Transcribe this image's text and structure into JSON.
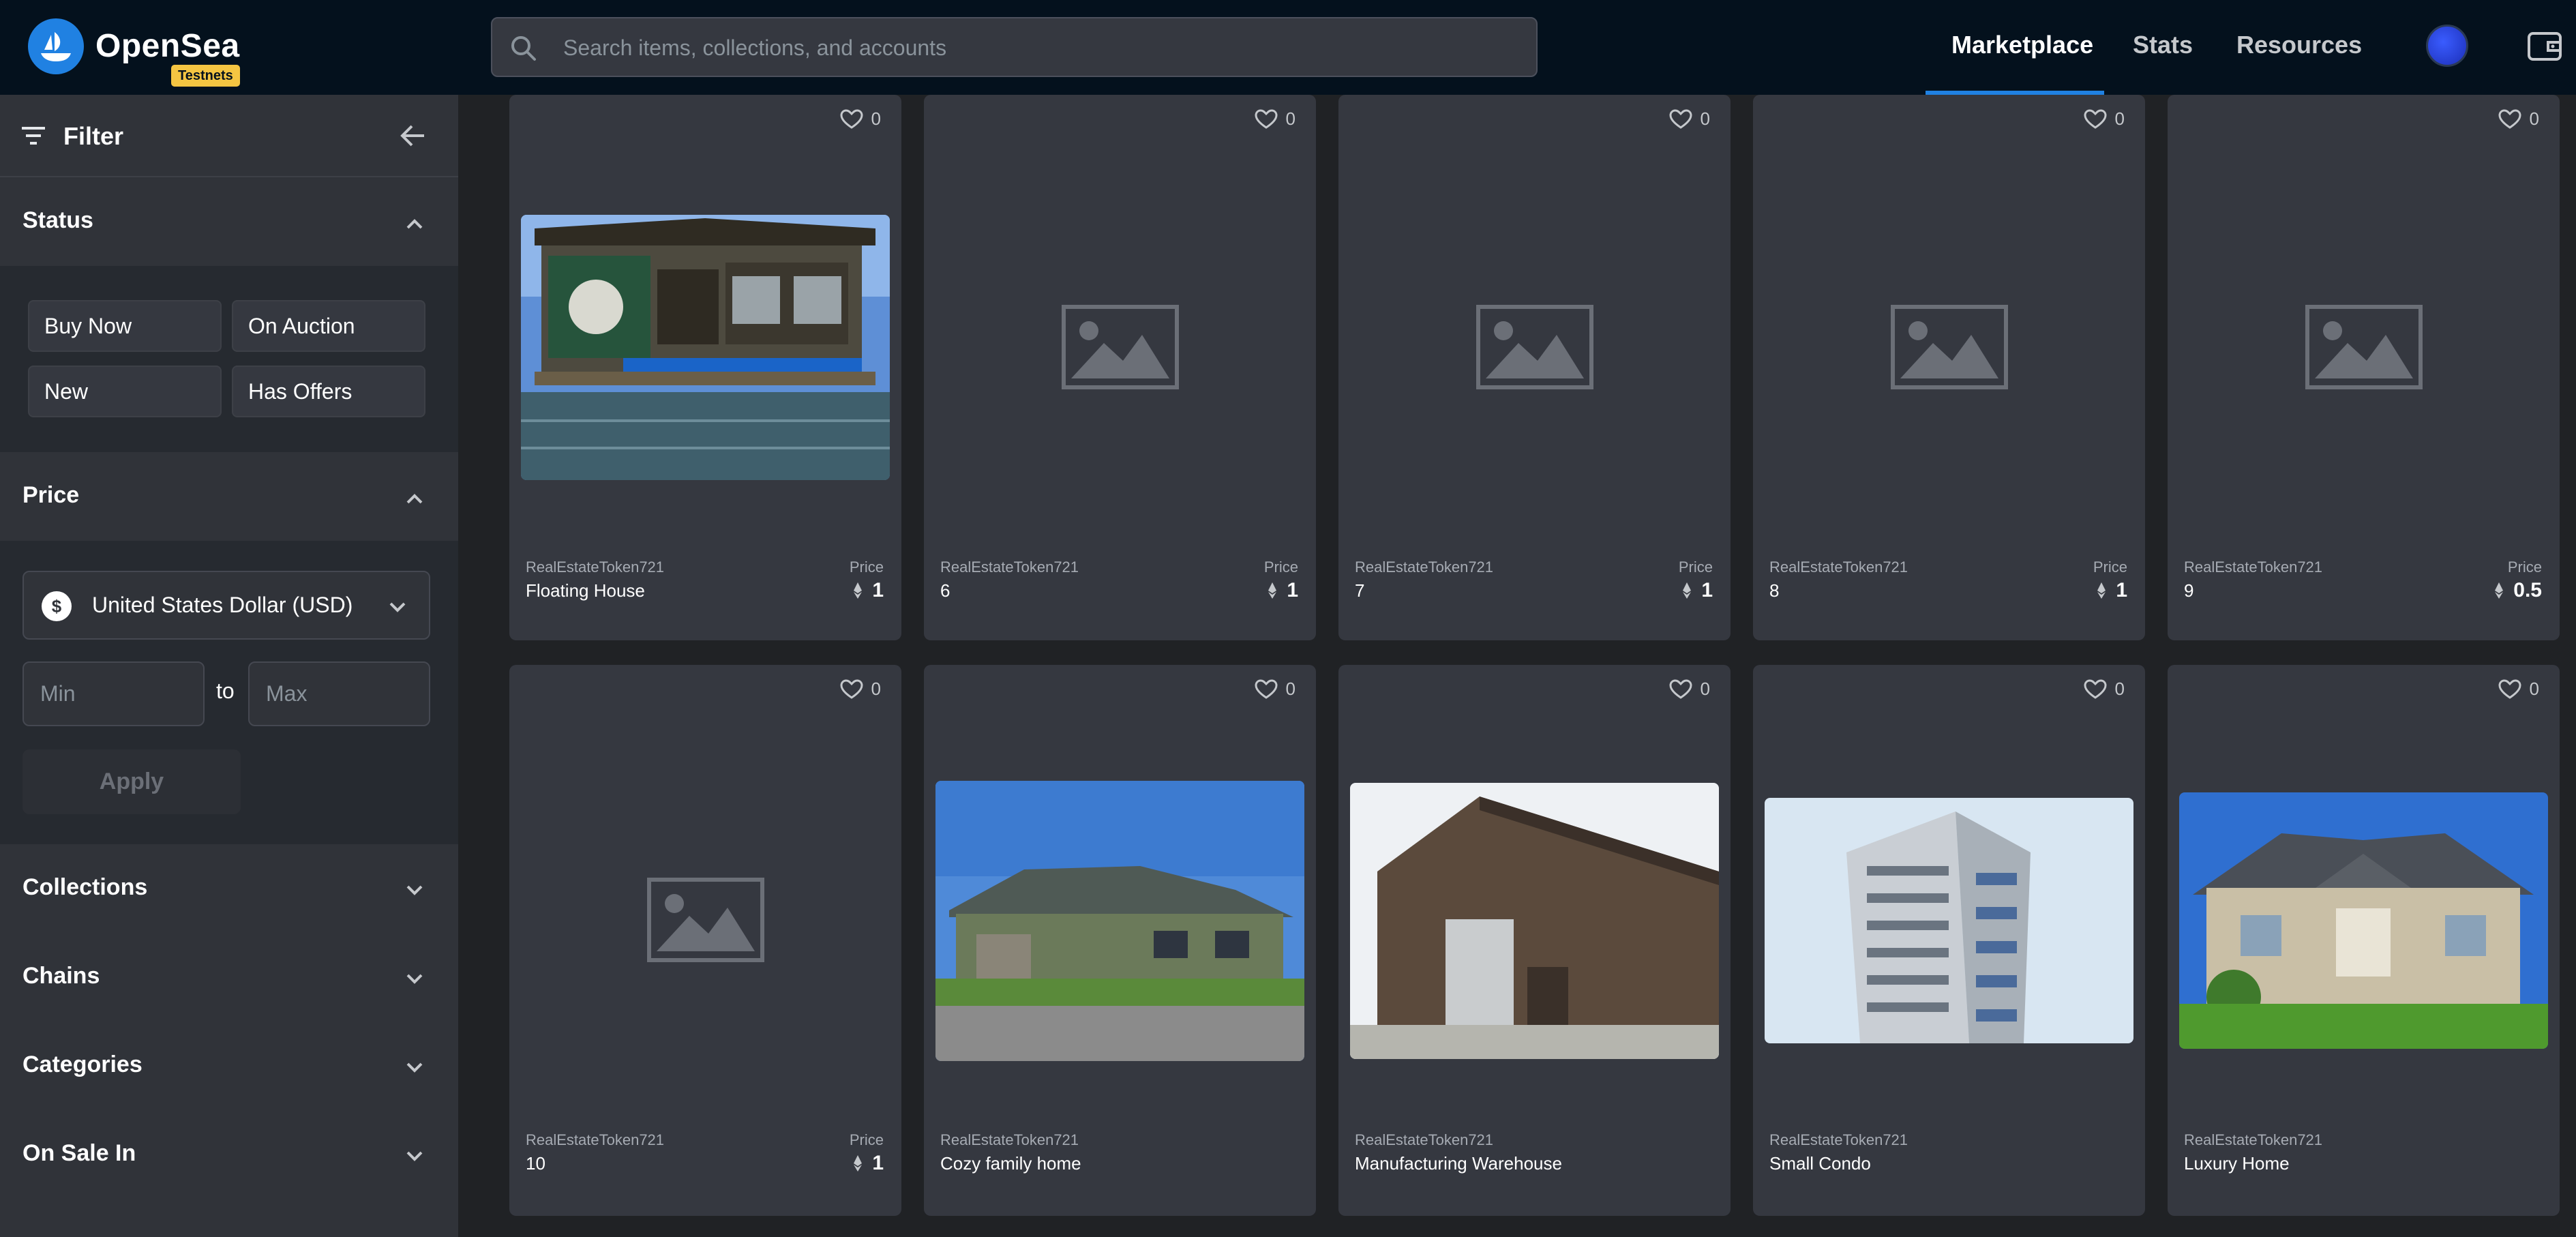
{
  "header": {
    "brand": "OpenSea",
    "badge": "Testnets",
    "search_placeholder": "Search items, collections, and accounts",
    "nav": [
      "Marketplace",
      "Stats",
      "Resources"
    ],
    "active_nav": "Marketplace",
    "accent": "#2081e2"
  },
  "sidebar": {
    "filter_label": "Filter",
    "status": {
      "title": "Status",
      "options": [
        "Buy Now",
        "On Auction",
        "New",
        "Has Offers"
      ]
    },
    "price": {
      "title": "Price",
      "currency_symbol": "$",
      "currency": "United States Dollar (USD)",
      "min_placeholder": "Min",
      "max_placeholder": "Max",
      "to_label": "to",
      "apply_label": "Apply"
    },
    "collapsed_sections": [
      "Collections",
      "Chains",
      "Categories",
      "On Sale In"
    ]
  },
  "cards": [
    {
      "collection": "RealEstateToken721",
      "name": "Floating House",
      "price_label": "Price",
      "price": "1",
      "likes": "0",
      "image": "houseboat"
    },
    {
      "collection": "RealEstateToken721",
      "name": "6",
      "price_label": "Price",
      "price": "1",
      "likes": "0",
      "image": "placeholder"
    },
    {
      "collection": "RealEstateToken721",
      "name": "7",
      "price_label": "Price",
      "price": "1",
      "likes": "0",
      "image": "placeholder"
    },
    {
      "collection": "RealEstateToken721",
      "name": "8",
      "price_label": "Price",
      "price": "1",
      "likes": "0",
      "image": "placeholder"
    },
    {
      "collection": "RealEstateToken721",
      "name": "9",
      "price_label": "Price",
      "price": "0.5",
      "likes": "0",
      "image": "placeholder"
    },
    {
      "collection": "RealEstateToken721",
      "name": "10",
      "price_label": "Price",
      "price": "1",
      "likes": "0",
      "image": "placeholder"
    },
    {
      "collection": "RealEstateToken721",
      "name": "Cozy family home",
      "price_label": "",
      "price": "",
      "likes": "0",
      "image": "family-home"
    },
    {
      "collection": "RealEstateToken721",
      "name": "Manufacturing Warehouse",
      "price_label": "",
      "price": "",
      "likes": "0",
      "image": "warehouse"
    },
    {
      "collection": "RealEstateToken721",
      "name": "Small Condo",
      "price_label": "",
      "price": "",
      "likes": "0",
      "image": "condo"
    },
    {
      "collection": "RealEstateToken721",
      "name": "Luxury Home",
      "price_label": "",
      "price": "",
      "likes": "0",
      "image": "luxury-home"
    }
  ]
}
